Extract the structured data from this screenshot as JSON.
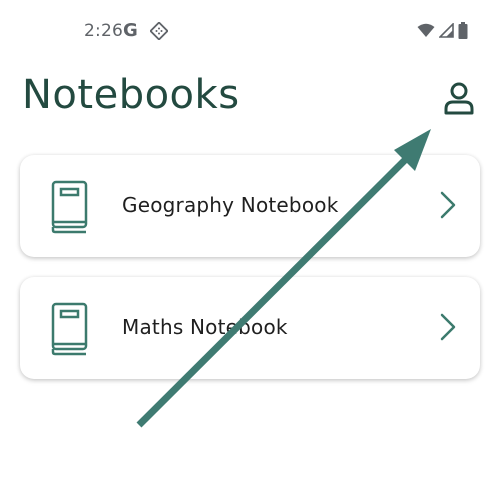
{
  "status_bar": {
    "time": "2:26",
    "g_letter": "G",
    "icons": [
      "google-icon",
      "app-diamond-icon",
      "wifi-icon",
      "signal-icon",
      "battery-icon"
    ]
  },
  "header": {
    "title": "Notebooks",
    "profile_icon": "person-icon"
  },
  "notebooks": [
    {
      "label": "Geography Notebook",
      "icon": "book-icon",
      "action_icon": "chevron-right-icon"
    },
    {
      "label": "Maths Notebook",
      "icon": "book-icon",
      "action_icon": "chevron-right-icon"
    }
  ],
  "colors": {
    "accent": "#3c7a6d",
    "title": "#234a40",
    "arrow": "#3f7b72"
  }
}
